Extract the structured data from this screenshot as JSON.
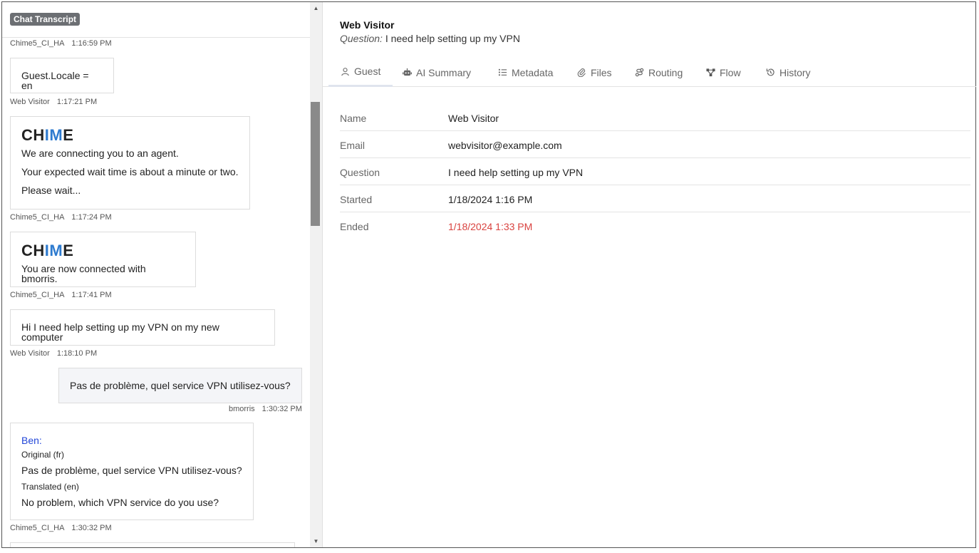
{
  "transcript": {
    "badge": "Chat Transcript",
    "messages": [
      {
        "sender": "Chime5_CI_HA",
        "time": "1:16:59 PM",
        "text": "Guest.Locale = en"
      },
      {
        "sender": "Web Visitor",
        "time": "1:17:21 PM",
        "logo": {
          "pre": "CH",
          "mid": "IM",
          "post": "E"
        },
        "lines": [
          "We are connecting you to an agent.",
          "Your expected wait time is about a minute or two.",
          "Please wait..."
        ]
      },
      {
        "sender": "Chime5_CI_HA",
        "time": "1:17:24 PM",
        "logo": {
          "pre": "CH",
          "mid": "IM",
          "post": "E"
        },
        "lines": [
          "You are now connected with bmorris."
        ]
      },
      {
        "sender": "Chime5_CI_HA",
        "time": "1:17:41 PM",
        "text": "Hi I need help setting up my VPN on my new computer"
      },
      {
        "sender": "Web Visitor",
        "time": "1:18:10 PM",
        "text": "Pas de problème, quel service VPN utilisez-vous?"
      },
      {
        "sender": "bmorris",
        "time": "1:30:32 PM",
        "name": "Ben",
        "original_label": "Original (fr)",
        "original": "Pas de problème, quel service VPN utilisez-vous?",
        "translated_label": "Translated (en)",
        "translated": "No problem, which VPN service do you use?"
      },
      {
        "sender": "Chime5_CI_HA",
        "time": "1:30:32 PM"
      }
    ]
  },
  "visitor": {
    "name": "Web Visitor",
    "question_label": "Question:",
    "question": "I need help setting up my VPN"
  },
  "tabs": [
    {
      "label": "Guest",
      "icon": "user-icon",
      "active": true
    },
    {
      "label": "AI Summary",
      "icon": "robot-icon"
    },
    {
      "label": "Metadata",
      "icon": "list-icon"
    },
    {
      "label": "Files",
      "icon": "paperclip-icon"
    },
    {
      "label": "Routing",
      "icon": "routing-icon"
    },
    {
      "label": "Flow",
      "icon": "flow-icon"
    },
    {
      "label": "History",
      "icon": "history-icon"
    }
  ],
  "guest": {
    "rows": [
      {
        "key": "Name",
        "value": "Web Visitor"
      },
      {
        "key": "Email",
        "value": "webvisitor@example.com"
      },
      {
        "key": "Question",
        "value": "I need help setting up my VPN"
      },
      {
        "key": "Started",
        "value": "1/18/2024 1:16 PM"
      },
      {
        "key": "Ended",
        "value": "1/18/2024 1:33 PM"
      }
    ]
  },
  "colors": {
    "accent_blue": "#2e7bcf",
    "ended_red": "#d9423f",
    "badge_gray": "#6c6f73",
    "name_blue": "#2246d8"
  }
}
